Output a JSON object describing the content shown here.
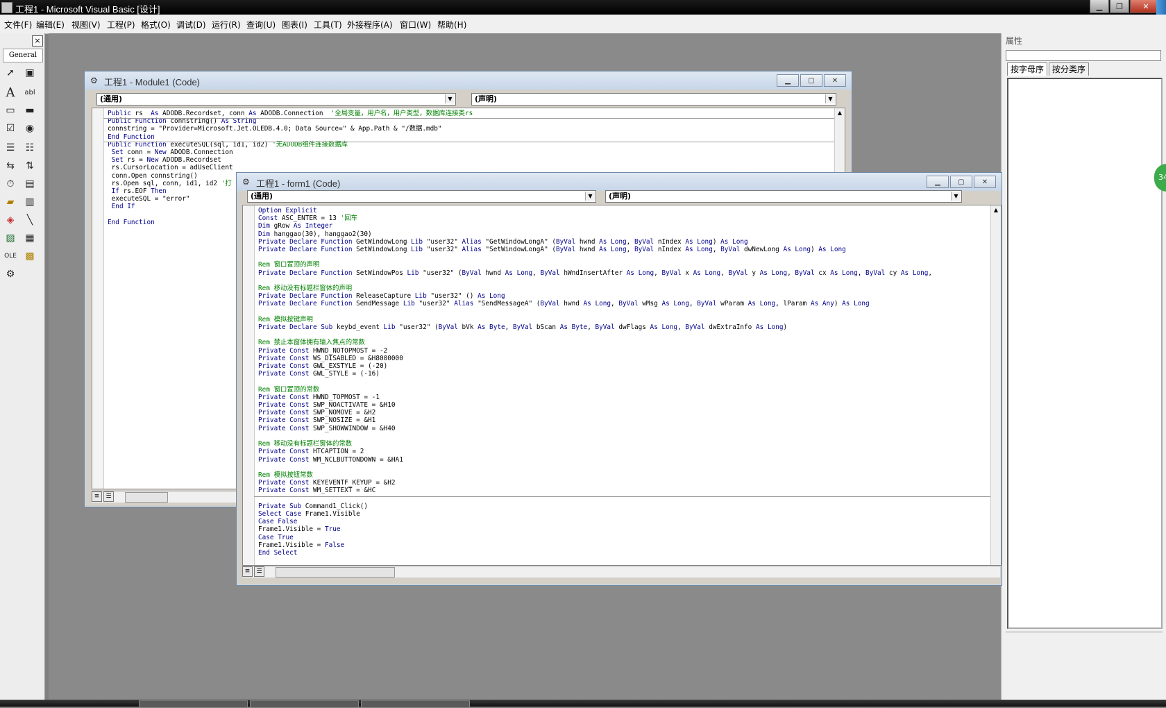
{
  "window": {
    "title": "工程1 - Microsoft Visual Basic [设计]"
  },
  "menubar": {
    "items": [
      "文件(F)",
      "编辑(E)",
      "视图(V)",
      "工程(P)",
      "格式(O)",
      "调试(D)",
      "运行(R)",
      "查询(U)",
      "图表(I)",
      "工具(T)",
      "外接程序(A)",
      "窗口(W)",
      "帮助(H)"
    ]
  },
  "toolbox": {
    "tab_label": "General",
    "close_label": "×"
  },
  "properties": {
    "title": "属性",
    "tab_alpha": "按字母序",
    "tab_category": "按分类序"
  },
  "module_window": {
    "title": "工程1 - Module1 (Code)",
    "object_combo": "(通用)",
    "proc_combo": "(声明)"
  },
  "form_window": {
    "title": "工程1 - form1 (Code)",
    "object_combo": "(通用)",
    "proc_combo": "(声明)"
  },
  "badge": {
    "text": "34"
  }
}
